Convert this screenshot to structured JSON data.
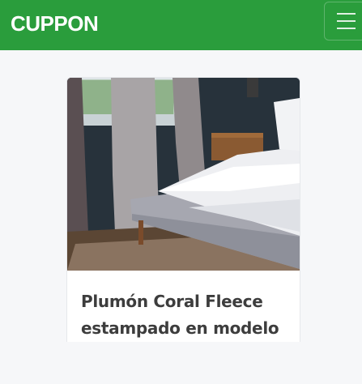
{
  "navbar": {
    "brand": "CUPPON",
    "brand_color": "#2a9d3c",
    "menu_icon": "hamburger-menu-icon"
  },
  "card": {
    "image_description_icon": "bedroom-product-photo",
    "title": "Plumón Coral Fleece estampado en modelo y"
  }
}
